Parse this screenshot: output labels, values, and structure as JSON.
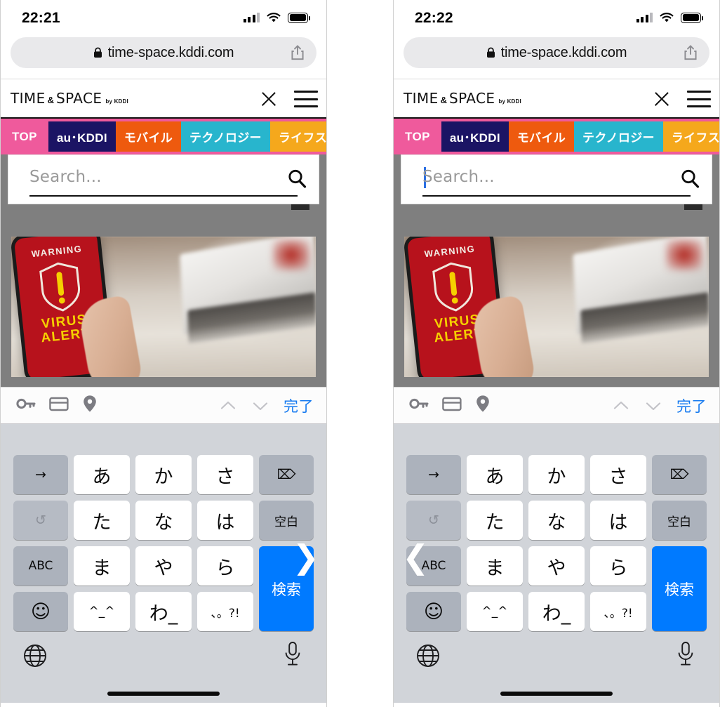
{
  "meta": {
    "description": "Two side-by-side iPhone Safari screenshots of the TIME & SPACE by KDDI mobile site with the search overlay open and the Japanese kana keyboard visible",
    "panel_count": 2
  },
  "panels": [
    {
      "id": "left",
      "status": {
        "time": "22:21",
        "signal_icon": "cellular-bars-icon",
        "wifi_icon": "wifi-icon",
        "battery_icon": "battery-full-icon"
      },
      "browser": {
        "url": "time-space.kddi.com",
        "lock_icon": "lock-icon",
        "share_icon": "share-icon"
      },
      "search": {
        "placeholder": "Search...",
        "value": "",
        "caret_visible": false,
        "search_icon": "magnifier-icon"
      },
      "swipe_hint": {
        "icon": "chevron-right-icon",
        "glyph": "❯"
      }
    },
    {
      "id": "right",
      "status": {
        "time": "22:22",
        "signal_icon": "cellular-bars-icon",
        "wifi_icon": "wifi-icon",
        "battery_icon": "battery-full-icon"
      },
      "browser": {
        "url": "time-space.kddi.com",
        "lock_icon": "lock-icon",
        "share_icon": "share-icon"
      },
      "search": {
        "placeholder": "Search...",
        "value": "",
        "caret_visible": true,
        "search_icon": "magnifier-icon"
      },
      "swipe_hint": {
        "icon": "chevron-left-icon",
        "glyph": "❮"
      }
    }
  ],
  "site_header": {
    "logo_main_1": "TIME",
    "logo_amp": "&",
    "logo_main_2": "SPACE",
    "logo_by": "by KDDI",
    "close_icon": "close-icon",
    "menu_icon": "hamburger-menu-icon"
  },
  "nav": {
    "background": "#ef5a9c",
    "tabs": [
      {
        "label": "TOP",
        "bg": "#ef5a9c",
        "color": "#ffffff",
        "active": true
      },
      {
        "label": "au･KDDI",
        "bg": "#1b1464",
        "color": "#ffffff",
        "active": false
      },
      {
        "label": "モバイル",
        "bg": "#ee5a0e",
        "color": "#ffffff",
        "active": false
      },
      {
        "label": "テクノロジー",
        "bg": "#28b5cd",
        "color": "#ffffff",
        "active": false
      },
      {
        "label": "ライフスタイ",
        "bg": "#f5a81c",
        "color": "#ffffff",
        "active": false
      }
    ]
  },
  "article_image": {
    "alt": "hand holding a smartphone showing a red virus alert screen in front of a blurred laptop",
    "phone_screen": {
      "warning": "WARNING",
      "virus": "VIRUS",
      "alert": "ALERT",
      "shield_icon": "shield-exclamation-icon",
      "bg": "#b7121c",
      "text_color": "#f5d000"
    }
  },
  "accessory_bar": {
    "password_icon": "key-icon",
    "card_icon": "credit-card-icon",
    "location_icon": "map-pin-icon",
    "prev_icon": "chevron-up-icon",
    "next_icon": "chevron-down-icon",
    "done_label": "完了",
    "done_color": "#1479f0"
  },
  "keyboard": {
    "type": "japanese-kana-10key",
    "rows": [
      [
        {
          "label": "→",
          "style": "dark",
          "name": "key-arrow-right"
        },
        {
          "label": "あ",
          "style": "light",
          "name": "key-a"
        },
        {
          "label": "か",
          "style": "light",
          "name": "key-ka"
        },
        {
          "label": "さ",
          "style": "light",
          "name": "key-sa"
        },
        {
          "label": "⌦",
          "style": "dark",
          "name": "key-delete"
        }
      ],
      [
        {
          "label": "↺",
          "style": "dim",
          "name": "key-undo"
        },
        {
          "label": "た",
          "style": "light",
          "name": "key-ta"
        },
        {
          "label": "な",
          "style": "light",
          "name": "key-na"
        },
        {
          "label": "は",
          "style": "light",
          "name": "key-ha"
        },
        {
          "label": "空白",
          "style": "dark",
          "name": "key-space"
        }
      ],
      [
        {
          "label": "ABC",
          "style": "dark",
          "name": "key-abc"
        },
        {
          "label": "ま",
          "style": "light",
          "name": "key-ma"
        },
        {
          "label": "や",
          "style": "light",
          "name": "key-ya"
        },
        {
          "label": "ら",
          "style": "light",
          "name": "key-ra"
        },
        {
          "label": "検索",
          "style": "blue",
          "name": "key-search"
        }
      ],
      [
        {
          "label": "☺",
          "style": "dark",
          "name": "key-emoji"
        },
        {
          "label": "^_^",
          "style": "light",
          "name": "key-kaomoji"
        },
        {
          "label": "わ_",
          "style": "light",
          "name": "key-wa"
        },
        {
          "label": "、。?!",
          "style": "light",
          "name": "key-punctuation"
        }
      ]
    ],
    "bottom": {
      "globe_icon": "globe-icon",
      "mic_icon": "microphone-icon"
    },
    "search_key_color": "#007aff"
  }
}
